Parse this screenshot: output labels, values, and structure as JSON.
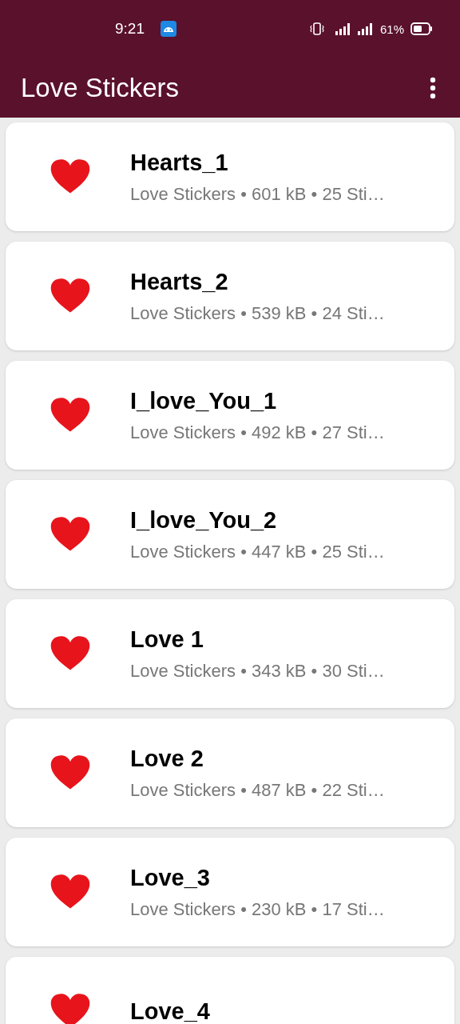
{
  "status_bar": {
    "time": "9:21",
    "battery": "61%"
  },
  "app_bar": {
    "title": "Love Stickers"
  },
  "packs": [
    {
      "title": "Hearts_1",
      "subtitle": "Love Stickers • 601 kB • 25 Sti…"
    },
    {
      "title": "Hearts_2",
      "subtitle": "Love Stickers • 539 kB • 24 Sti…"
    },
    {
      "title": "I_love_You_1",
      "subtitle": "Love Stickers • 492 kB • 27 Sti…"
    },
    {
      "title": "I_love_You_2",
      "subtitle": "Love Stickers • 447 kB • 25 Sti…"
    },
    {
      "title": "Love 1",
      "subtitle": "Love Stickers • 343 kB • 30 Sti…"
    },
    {
      "title": "Love 2",
      "subtitle": "Love Stickers • 487 kB • 22 Sti…"
    },
    {
      "title": "Love_3",
      "subtitle": "Love Stickers • 230 kB • 17 Sti…"
    },
    {
      "title": "Love_4"
    }
  ]
}
